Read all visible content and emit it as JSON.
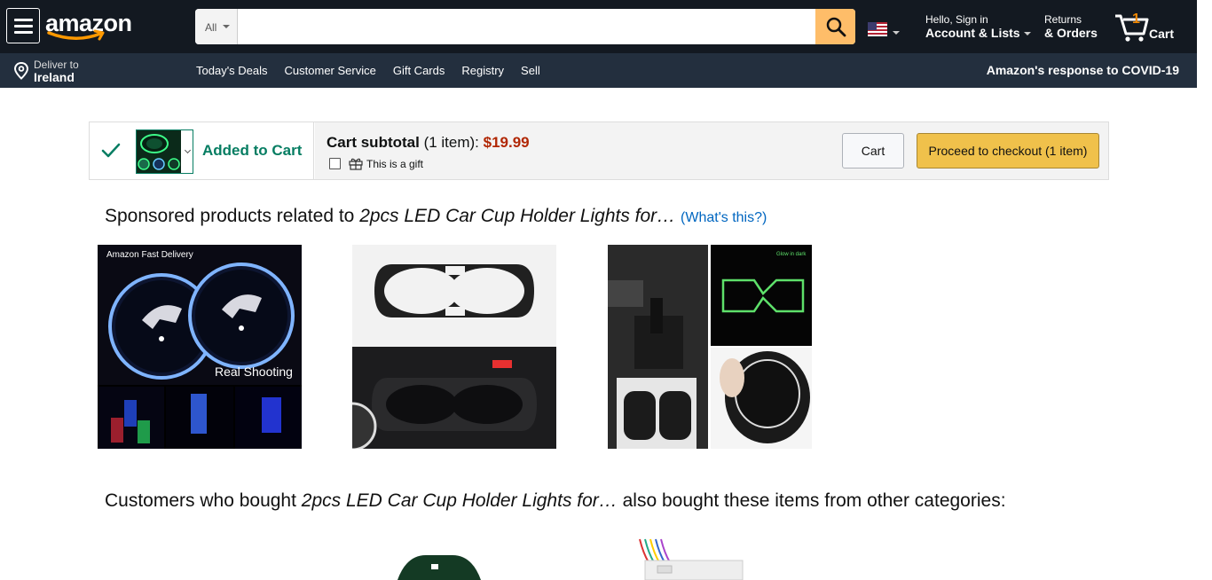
{
  "nav": {
    "logo": "amazon",
    "search_category": "All",
    "search_placeholder": "",
    "account_line1": "Hello, Sign in",
    "account_line2": "Account & Lists",
    "returns_line1": "Returns",
    "returns_line2": "& Orders",
    "cart_count": "1",
    "cart_label": "Cart"
  },
  "subnav": {
    "deliver_line1": "Deliver to",
    "deliver_line2": "Ireland",
    "links": [
      "Today's Deals",
      "Customer Service",
      "Gift Cards",
      "Registry",
      "Sell"
    ],
    "covid": "Amazon's response to COVID-19"
  },
  "added": {
    "label": "Added to Cart",
    "subtotal_label": "Cart subtotal",
    "subtotal_items": " (1 item): ",
    "subtotal_price": "$19.99",
    "gift_label": "This is a gift",
    "cart_button": "Cart",
    "checkout_button": "Proceed to checkout (1 item)"
  },
  "sponsored": {
    "prefix": "Sponsored products related to ",
    "product": "2pcs LED Car Cup Holder Lights for…",
    "whats_this": "(What's this?)",
    "image1_text_top": "Amazon Fast Delivery",
    "image1_text_bottom": "Real Shooting",
    "image3_text": "Glow in dark"
  },
  "customers": {
    "prefix": "Customers who bought ",
    "product": "2pcs LED Car Cup Holder Lights for…",
    "suffix": " also bought these items from other categories:"
  },
  "colors": {
    "nav_bg": "#131921",
    "subnav_bg": "#232f3e",
    "search_button": "#febd69",
    "added_green": "#067d62",
    "price_red": "#b12704",
    "link_blue": "#0066c0",
    "checkout_yellow": "#f0c14b"
  },
  "icons": [
    "menu-icon",
    "search-icon",
    "us-flag-icon",
    "cart-icon",
    "location-pin-icon",
    "checkmark-icon",
    "gift-icon"
  ]
}
